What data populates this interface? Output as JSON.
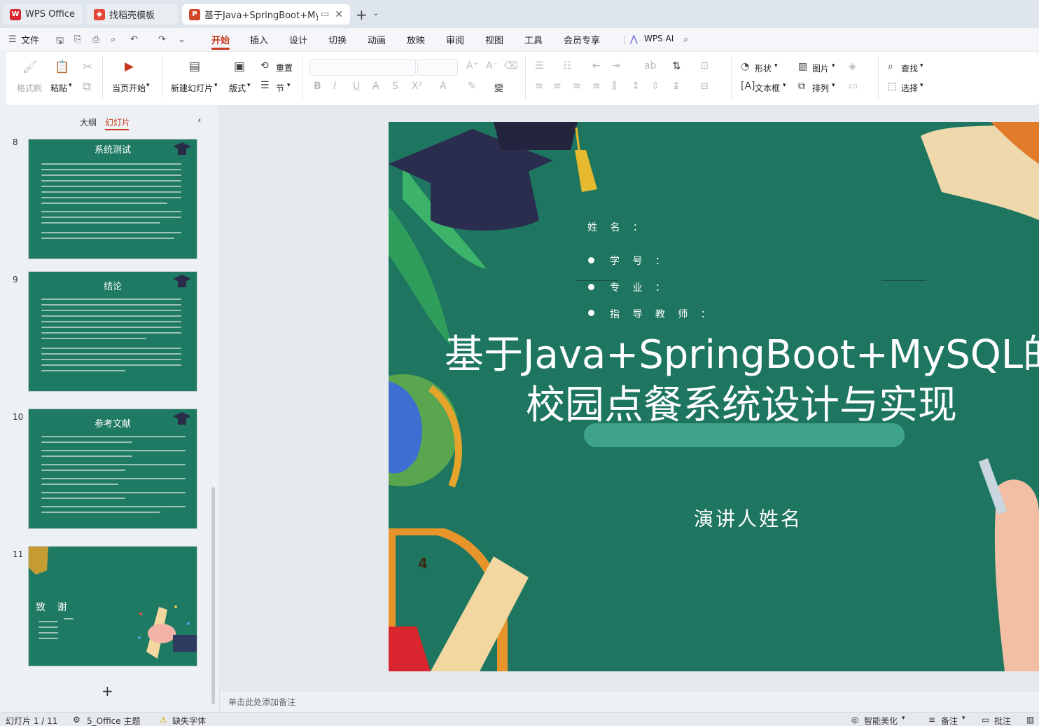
{
  "tabs": [
    {
      "label": "WPS Office",
      "icon": "wps-logo-icon",
      "color": "#d9262e"
    },
    {
      "label": "找稻壳模板",
      "icon": "docer-icon",
      "color": "#e6463a"
    },
    {
      "label": "基于Java+SpringBoot+MyS(",
      "icon": "ppt-icon",
      "color": "#d24726"
    }
  ],
  "menu": {
    "file": "文件",
    "items": [
      "开始",
      "插入",
      "设计",
      "切换",
      "动画",
      "放映",
      "审阅",
      "视图",
      "工具",
      "会员专享"
    ],
    "active": "开始",
    "wps_ai": "WPS AI"
  },
  "ribbon": {
    "format_painter": "格式刷",
    "paste": "粘贴",
    "play_current": "当页开始",
    "new_slide": "新建幻灯片",
    "layout": "版式",
    "reset": "重置",
    "section": "节",
    "shape": "形状",
    "picture": "图片",
    "textbox": "文本框",
    "arrange": "排列",
    "find": "查找",
    "select": "选择"
  },
  "left_panel": {
    "tab_outline": "大纲",
    "tab_slides": "幻灯片",
    "slides": [
      {
        "num": "8",
        "title": "系统测试"
      },
      {
        "num": "9",
        "title": "结论"
      },
      {
        "num": "10",
        "title": "参考文献"
      },
      {
        "num": "11",
        "title": "致 谢"
      }
    ]
  },
  "slide": {
    "name_label": "姓 名 ：",
    "student_id": "学 号 ：",
    "major": "专 业 ：",
    "advisor": "指 导 教 师 ：",
    "title_line1": "基于Java+SpringBoot+MySQL的",
    "title_line2": "校园点餐系统设计与实现",
    "speaker": "演讲人姓名",
    "ruler_mark": "4",
    "bg_color": "#1e7660"
  },
  "notes_placeholder": "单击此处添加备注",
  "status": {
    "slide_pos": "幻灯片 1 / 11",
    "theme": "5_Office 主题",
    "missing_font": "缺失字体",
    "beautify": "智能美化",
    "notes": "备注",
    "comments": "批注"
  }
}
